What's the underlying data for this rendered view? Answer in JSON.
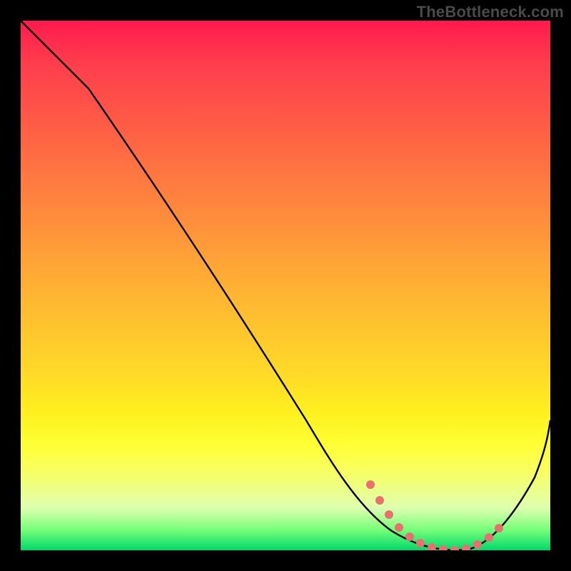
{
  "watermark": "TheBottleneck.com",
  "colors": {
    "curve_stroke": "#000000",
    "marker_fill": "#e8706f",
    "background": "#000000"
  },
  "chart_data": {
    "type": "line",
    "title": "",
    "xlabel": "",
    "ylabel": "",
    "xlim": [
      0,
      100
    ],
    "ylim": [
      0,
      100
    ],
    "series": [
      {
        "name": "curve",
        "x": [
          0,
          5,
          12,
          20,
          30,
          40,
          50,
          60,
          66,
          70,
          74,
          78,
          82,
          86,
          90,
          94,
          100
        ],
        "y": [
          100,
          96,
          90,
          80,
          67,
          54,
          41,
          28,
          17,
          10,
          5,
          2,
          1,
          1.5,
          4,
          10,
          25
        ]
      }
    ],
    "markers": {
      "name": "highlight",
      "x": [
        66,
        68,
        70,
        72,
        74,
        76,
        78,
        80,
        82,
        84,
        86,
        88,
        90
      ],
      "y": [
        17,
        13,
        10,
        7,
        5,
        3,
        2,
        1.5,
        1,
        1,
        1.5,
        2.5,
        4
      ]
    }
  }
}
